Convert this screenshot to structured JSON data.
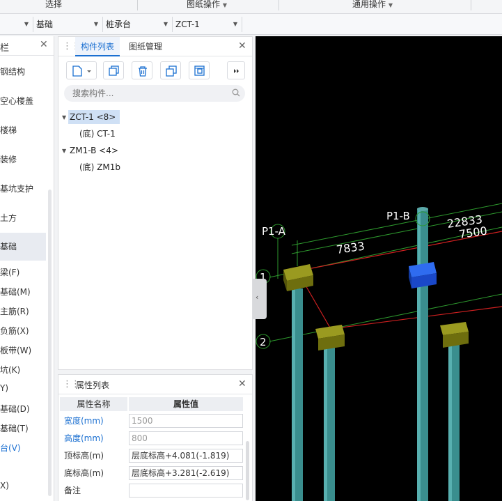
{
  "menubar": {
    "select_label": "选择",
    "drawing_ops_label": "图纸操作",
    "general_ops_label": "通用操作"
  },
  "combos": [
    {
      "value": ""
    },
    {
      "value": "基础"
    },
    {
      "value": "桩承台"
    },
    {
      "value": "ZCT-1"
    }
  ],
  "left_panel": {
    "title": "栏",
    "items": [
      {
        "label": "钢结构"
      },
      {
        "label": "空心楼盖"
      },
      {
        "label": "楼梯"
      },
      {
        "label": "装修"
      },
      {
        "label": "基坑支护"
      },
      {
        "label": "土方"
      },
      {
        "label": "基础"
      },
      {
        "label": "梁(F)"
      },
      {
        "label": "基础(M)"
      },
      {
        "label": "主筋(R)"
      },
      {
        "label": "负筋(X)"
      },
      {
        "label": "板带(W)"
      },
      {
        "label": "坑(K)"
      },
      {
        "label": "Y)"
      },
      {
        "label": "基础(D)"
      },
      {
        "label": "基础(T)"
      },
      {
        "label": "台(V)"
      },
      {
        "label": "X)"
      }
    ]
  },
  "component_panel": {
    "tab_components": "构件列表",
    "tab_drawings": "图纸管理",
    "search_placeholder": "搜索构件...",
    "tree": [
      {
        "label": "ZCT-1 <8>"
      },
      {
        "label": "(底) CT-1"
      },
      {
        "label": "ZM1-B <4>"
      },
      {
        "label": "(底) ZM1b"
      }
    ]
  },
  "property_panel": {
    "title": "属性列表",
    "col_name": "属性名称",
    "col_value": "属性值",
    "rows": [
      {
        "name": "宽度(mm)",
        "value": "1500"
      },
      {
        "name": "高度(mm)",
        "value": "800"
      },
      {
        "name": "顶标高(m)",
        "value": "层底标高+4.081(-1.819)"
      },
      {
        "name": "底标高(m)",
        "value": "层底标高+3.281(-2.619)"
      },
      {
        "name": "备注",
        "value": ""
      }
    ]
  },
  "viewport": {
    "axis_labels": {
      "p1a": "P1-A",
      "p1b": "P1-B",
      "row1": "1",
      "row2": "2"
    },
    "dimensions": {
      "d1": "22833",
      "d2": "7500",
      "d3": "7833"
    },
    "colors": {
      "background": "#000000",
      "pile": "#3a8e8e",
      "cap": "#7a7a10",
      "selected_cap": "#1f5ae6",
      "grid_line": "#2e9a2e",
      "red_line": "#d02020"
    }
  },
  "collapse_arrow": "‹"
}
